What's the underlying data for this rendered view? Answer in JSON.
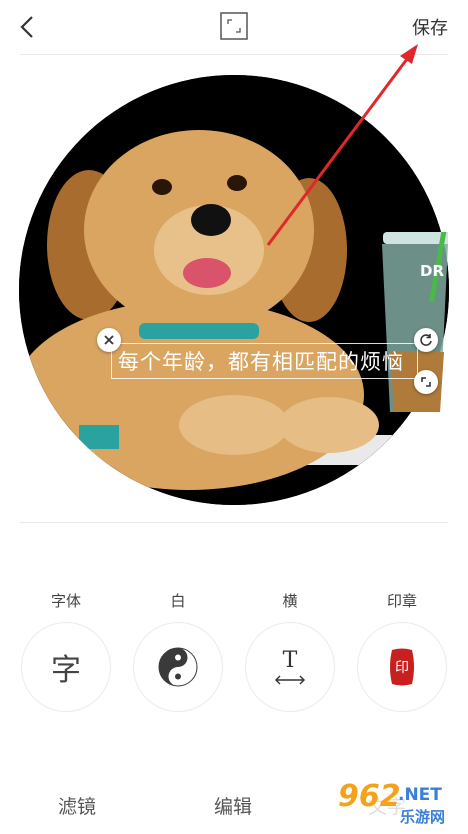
{
  "header": {
    "save_label": "保存"
  },
  "editor": {
    "overlay_text": "每个年龄，都有相匹配的烦恼",
    "cup_text": "DR"
  },
  "tools": [
    {
      "label": "字体",
      "icon": "font-icon",
      "glyph": "字"
    },
    {
      "label": "白",
      "icon": "yin-yang-icon"
    },
    {
      "label": "横",
      "icon": "horizontal-text-icon",
      "glyph": "T"
    },
    {
      "label": "印章",
      "icon": "seal-stamp-icon",
      "glyph": "印"
    }
  ],
  "tabs": [
    {
      "label": "滤镜"
    },
    {
      "label": "编辑"
    },
    {
      "label": "文字"
    }
  ],
  "watermark": {
    "brand": "962",
    "domain": ".NET",
    "site": "乐游网"
  },
  "colors": {
    "annotation_arrow": "#e3262c",
    "seal_red": "#c8201f"
  }
}
